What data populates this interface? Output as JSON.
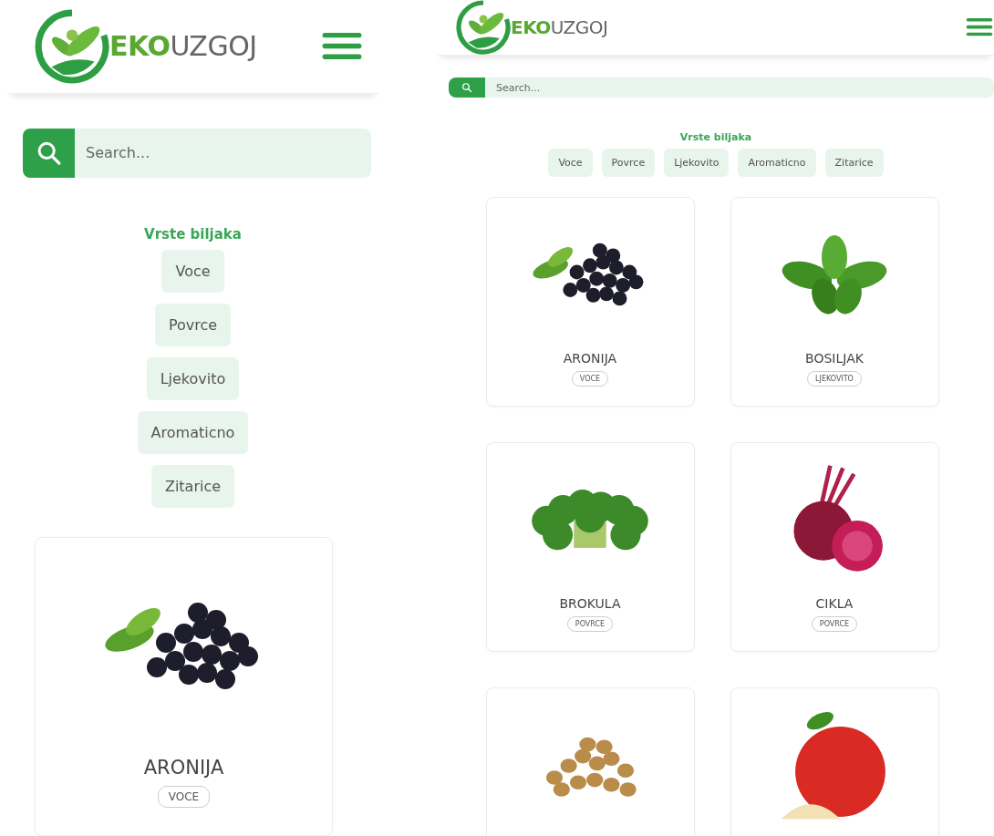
{
  "screens": [
    {
      "kind": "single",
      "logo": "**EKO**UZGOJ",
      "search": {
        "placeholder": "Search..."
      },
      "filter_title": "Vrste biljaka",
      "filters": [
        "Voce",
        "Povrce",
        "Ljekovito",
        "Aromaticno",
        "Zitarice"
      ],
      "products": [
        {
          "kind": "aronia",
          "name": "ARONIJA",
          "category": "VOCE"
        }
      ]
    },
    {
      "kind": "grid",
      "logo": "**EKO**UZGOJ",
      "search": {
        "placeholder": "Search..."
      },
      "filter_title": "Vrste biljaka",
      "filters": [
        "Voce",
        "Povrce",
        "Ljekovito",
        "Aromaticno",
        "Zitarice"
      ],
      "products": [
        {
          "kind": "aronia",
          "name": "ARONIJA",
          "category": "VOCE"
        },
        {
          "kind": "basil",
          "name": "BOSILJAK",
          "category": "LJEKOVITO"
        },
        {
          "kind": "broccoli",
          "name": "BROKULA",
          "category": "POVRCE"
        },
        {
          "kind": "beet",
          "name": "CIKLA",
          "category": "POVRCE"
        },
        {
          "kind": "grain"
        },
        {
          "kind": "apple"
        }
      ]
    }
  ]
}
